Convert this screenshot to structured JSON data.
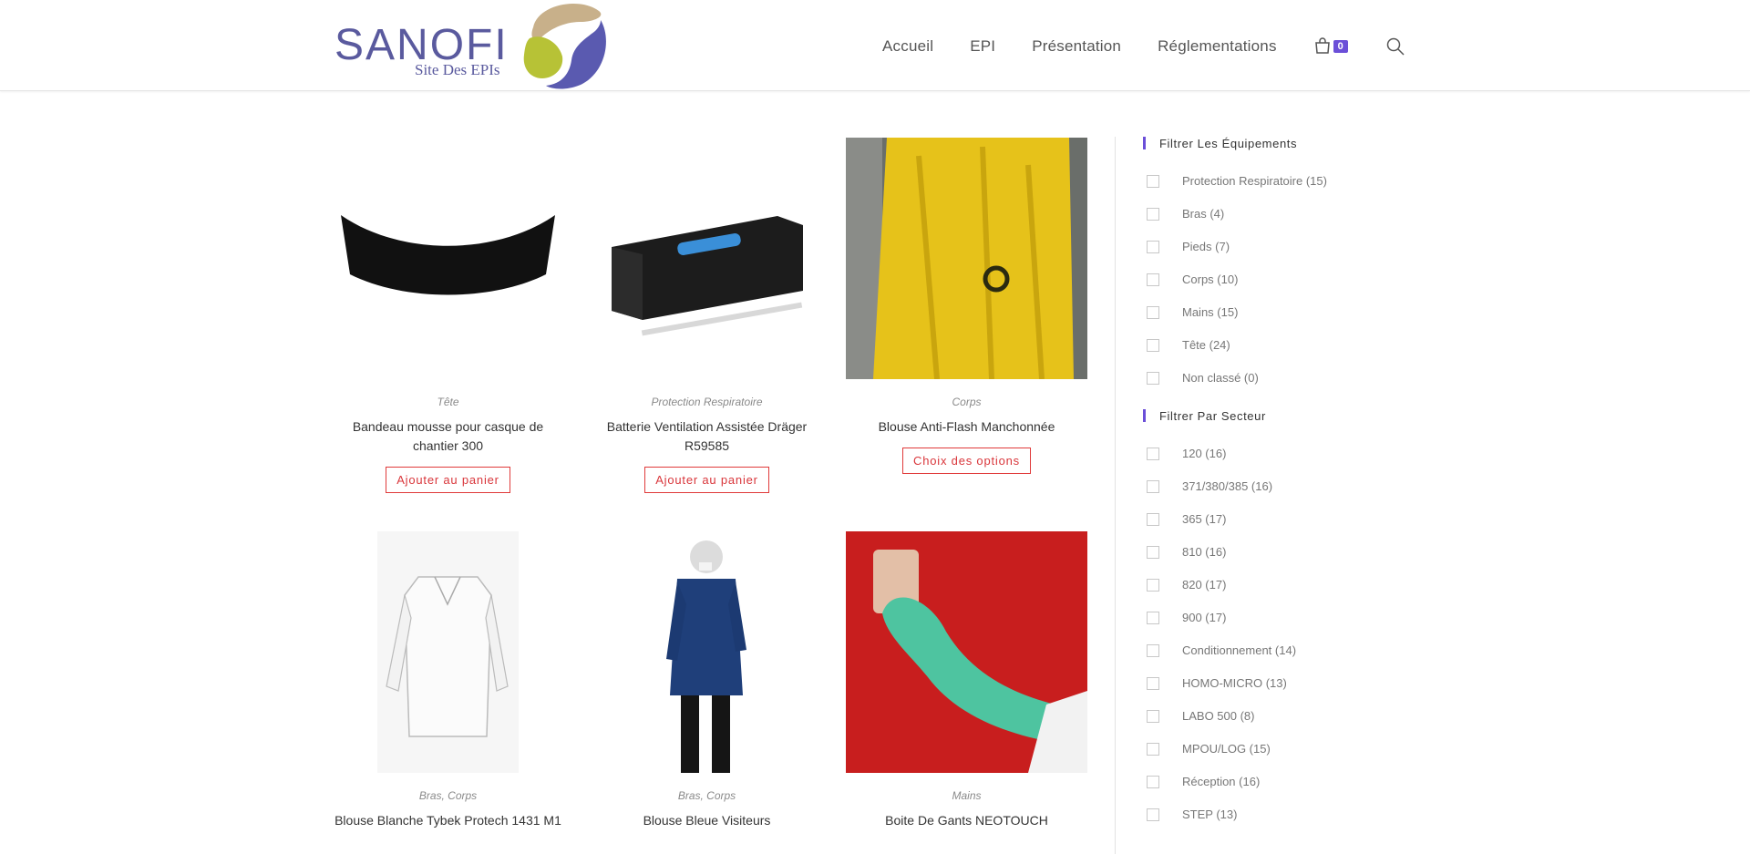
{
  "header": {
    "logo_word": "SANOFI",
    "logo_sub": "Site Des EPIs",
    "nav": [
      "Accueil",
      "EPI",
      "Présentation",
      "Réglementations"
    ],
    "cart_count": "0"
  },
  "products": [
    {
      "category": "Tête",
      "title": "Bandeau mousse pour casque de chantier 300",
      "button": "Ajouter au panier"
    },
    {
      "category": "Protection Respiratoire",
      "title": "Batterie Ventilation Assistée Dräger R59585",
      "button": "Ajouter au panier"
    },
    {
      "category": "Corps",
      "title": "Blouse Anti-Flash Manchonnée",
      "button": "Choix des options"
    },
    {
      "category": "Bras, Corps",
      "title": "Blouse Blanche Tybek Protech 1431 M1",
      "button": ""
    },
    {
      "category": "Bras, Corps",
      "title": "Blouse Bleue Visiteurs",
      "button": ""
    },
    {
      "category": "Mains",
      "title": "Boite De Gants NEOTOUCH",
      "button": ""
    }
  ],
  "sidebar": {
    "filter_equip_title": "Filtrer Les Équipements",
    "equipements": [
      "Protection Respiratoire (15)",
      "Bras (4)",
      "Pieds (7)",
      "Corps (10)",
      "Mains (15)",
      "Tête (24)",
      "Non classé (0)"
    ],
    "filter_secteur_title": "Filtrer Par Secteur",
    "secteurs": [
      "120 (16)",
      "371/380/385 (16)",
      "365 (17)",
      "810 (16)",
      "820 (17)",
      "900 (17)",
      "Conditionnement (14)",
      "HOMO-MICRO (13)",
      "LABO 500 (8)",
      "MPOU/LOG (15)",
      "Réception (16)",
      "STEP (13)"
    ]
  },
  "colors": {
    "accent": "#6b4fd8",
    "button_red": "#d9363b",
    "brand": "#5a5a9e"
  }
}
